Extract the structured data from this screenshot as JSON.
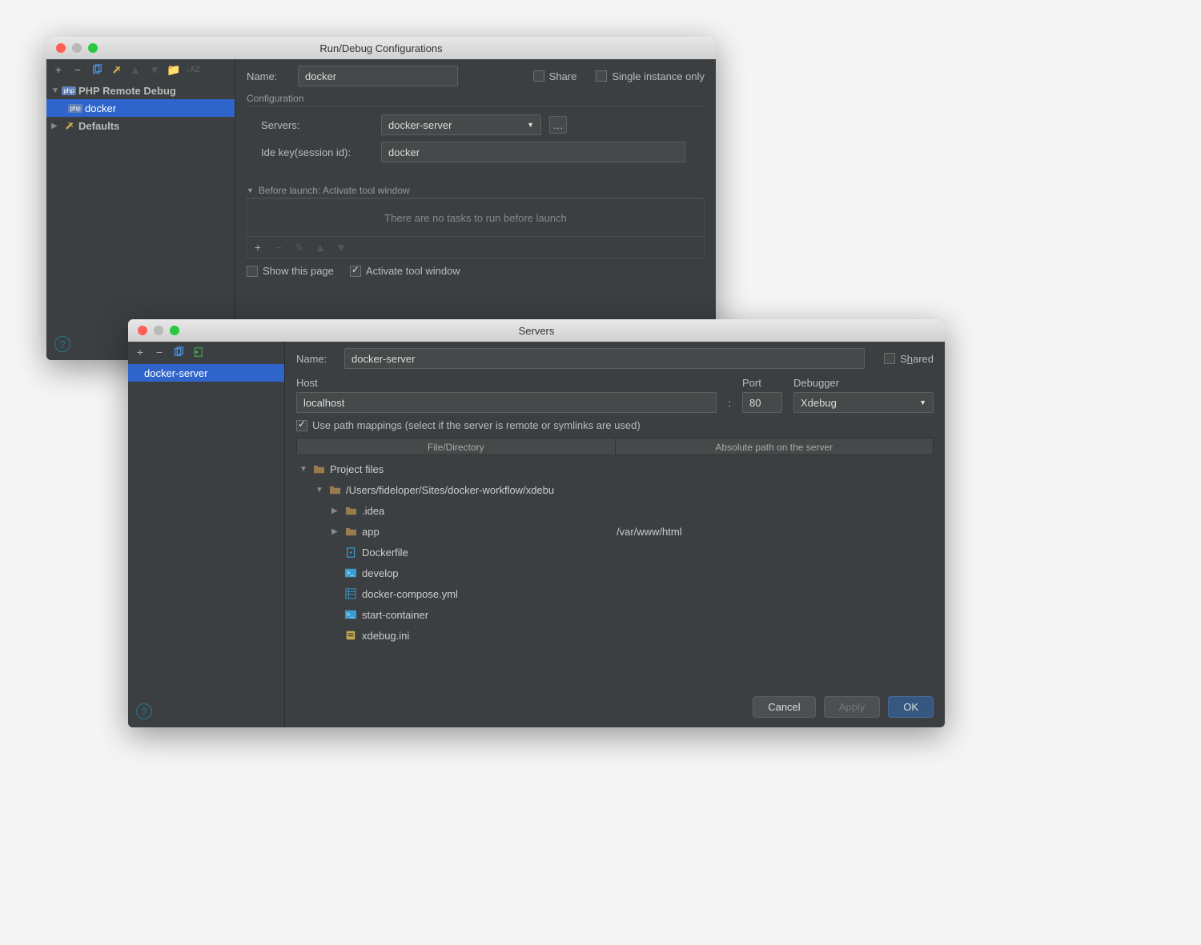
{
  "dialog1": {
    "title": "Run/Debug Configurations",
    "name_label": "Name:",
    "name_value": "docker",
    "share_label": "Share",
    "single_label": "Single instance only",
    "tree": {
      "group": "PHP Remote Debug",
      "item": "docker",
      "defaults": "Defaults"
    },
    "config_section": "Configuration",
    "servers_label": "Servers:",
    "servers_value": "docker-server",
    "idekey_label": "Ide key(session id):",
    "idekey_value": "docker",
    "before_section": "Before launch: Activate tool window",
    "before_empty": "There are no tasks to run before launch",
    "show_page": "Show this page",
    "activate_window": "Activate tool window"
  },
  "dialog2": {
    "title": "Servers",
    "tree_item": "docker-server",
    "name_label": "Name:",
    "name_value": "docker-server",
    "shared_label": "Shared",
    "host_label": "Host",
    "host_value": "localhost",
    "port_label": "Port",
    "port_value": "80",
    "debugger_label": "Debugger",
    "debugger_value": "Xdebug",
    "pathmap_label": "Use path mappings (select if the server is remote or symlinks are used)",
    "col1": "File/Directory",
    "col2": "Absolute path on the server",
    "files": {
      "project": "Project files",
      "root": "/Users/fideloper/Sites/docker-workflow/xdebu",
      "idea": ".idea",
      "app": "app",
      "app_path": "/var/www/html",
      "dockerfile": "Dockerfile",
      "develop": "develop",
      "compose": "docker-compose.yml",
      "start": "start-container",
      "xdebug": "xdebug.ini"
    },
    "cancel": "Cancel",
    "apply": "Apply",
    "ok": "OK"
  }
}
